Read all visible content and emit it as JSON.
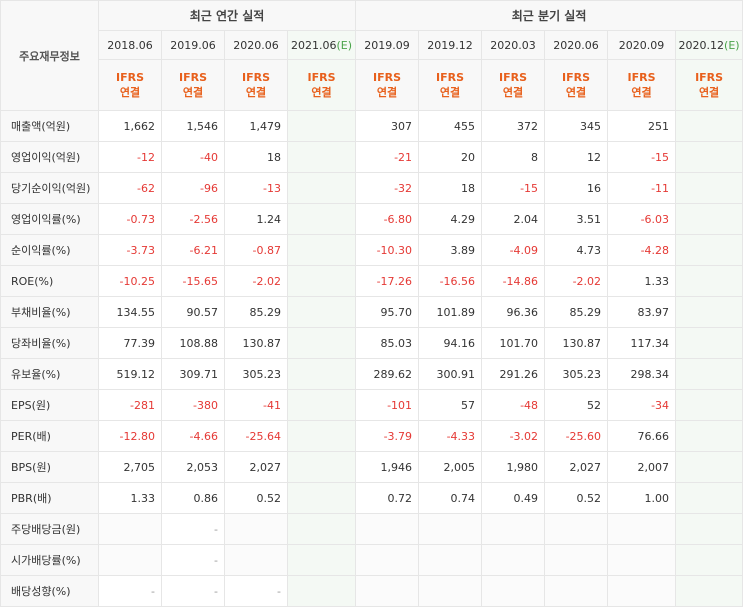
{
  "header": {
    "label_column": "주요재무정보",
    "annual_group": "최근 연간 실적",
    "quarterly_group": "최근 분기 실적",
    "annual_periods": [
      "2018.06",
      "2019.06",
      "2020.06",
      "2021.06"
    ],
    "annual_estimate_mark": "(E)",
    "quarterly_periods": [
      "2019.09",
      "2019.12",
      "2020.03",
      "2020.06",
      "2020.09",
      "2020.12"
    ],
    "quarterly_estimate_mark": "(E)",
    "ifrs_line1": "IFRS",
    "ifrs_line2": "연결"
  },
  "rows": [
    {
      "label": "매출액(억원)",
      "annual": [
        "1,662",
        "1,546",
        "1,479",
        ""
      ],
      "quarterly": [
        "307",
        "455",
        "372",
        "345",
        "251",
        ""
      ]
    },
    {
      "label": "영업이익(억원)",
      "annual": [
        "-12",
        "-40",
        "18",
        ""
      ],
      "quarterly": [
        "-21",
        "20",
        "8",
        "12",
        "-15",
        ""
      ]
    },
    {
      "label": "당기순이익(억원)",
      "annual": [
        "-62",
        "-96",
        "-13",
        ""
      ],
      "quarterly": [
        "-32",
        "18",
        "-15",
        "16",
        "-11",
        ""
      ]
    },
    {
      "label": "영업이익률(%)",
      "annual": [
        "-0.73",
        "-2.56",
        "1.24",
        ""
      ],
      "quarterly": [
        "-6.80",
        "4.29",
        "2.04",
        "3.51",
        "-6.03",
        ""
      ]
    },
    {
      "label": "순이익률(%)",
      "annual": [
        "-3.73",
        "-6.21",
        "-0.87",
        ""
      ],
      "quarterly": [
        "-10.30",
        "3.89",
        "-4.09",
        "4.73",
        "-4.28",
        ""
      ]
    },
    {
      "label": "ROE(%)",
      "annual": [
        "-10.25",
        "-15.65",
        "-2.02",
        ""
      ],
      "quarterly": [
        "-17.26",
        "-16.56",
        "-14.86",
        "-2.02",
        "1.33",
        ""
      ]
    },
    {
      "label": "부채비율(%)",
      "annual": [
        "134.55",
        "90.57",
        "85.29",
        ""
      ],
      "quarterly": [
        "95.70",
        "101.89",
        "96.36",
        "85.29",
        "83.97",
        ""
      ]
    },
    {
      "label": "당좌비율(%)",
      "annual": [
        "77.39",
        "108.88",
        "130.87",
        ""
      ],
      "quarterly": [
        "85.03",
        "94.16",
        "101.70",
        "130.87",
        "117.34",
        ""
      ]
    },
    {
      "label": "유보율(%)",
      "annual": [
        "519.12",
        "309.71",
        "305.23",
        ""
      ],
      "quarterly": [
        "289.62",
        "300.91",
        "291.26",
        "305.23",
        "298.34",
        ""
      ]
    },
    {
      "label": "EPS(원)",
      "annual": [
        "-281",
        "-380",
        "-41",
        ""
      ],
      "quarterly": [
        "-101",
        "57",
        "-48",
        "52",
        "-34",
        ""
      ]
    },
    {
      "label": "PER(배)",
      "annual": [
        "-12.80",
        "-4.66",
        "-25.64",
        ""
      ],
      "quarterly": [
        "-3.79",
        "-4.33",
        "-3.02",
        "-25.60",
        "76.66",
        ""
      ]
    },
    {
      "label": "BPS(원)",
      "annual": [
        "2,705",
        "2,053",
        "2,027",
        ""
      ],
      "quarterly": [
        "1,946",
        "2,005",
        "1,980",
        "2,027",
        "2,007",
        ""
      ]
    },
    {
      "label": "PBR(배)",
      "annual": [
        "1.33",
        "0.86",
        "0.52",
        ""
      ],
      "quarterly": [
        "0.72",
        "0.74",
        "0.49",
        "0.52",
        "1.00",
        ""
      ]
    },
    {
      "label": "주당배당금(원)",
      "annual": [
        "",
        "-",
        "",
        ""
      ],
      "quarterly": [
        "",
        "",
        "",
        "",
        "",
        ""
      ]
    },
    {
      "label": "시가배당률(%)",
      "annual": [
        "",
        "-",
        "",
        ""
      ],
      "quarterly": [
        "",
        "",
        "",
        "",
        "",
        ""
      ]
    },
    {
      "label": "배당성향(%)",
      "annual": [
        "-",
        "-",
        "-",
        ""
      ],
      "quarterly": [
        "",
        "",
        "",
        "",
        "",
        ""
      ]
    }
  ]
}
